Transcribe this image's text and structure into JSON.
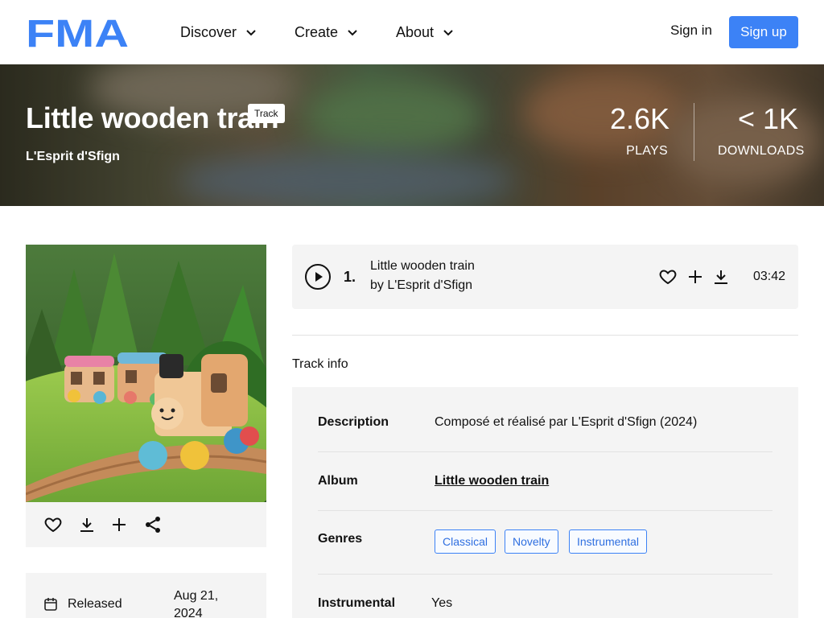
{
  "nav": {
    "logo_text": "FMA",
    "items": [
      {
        "label": "Discover"
      },
      {
        "label": "Create"
      },
      {
        "label": "About"
      }
    ],
    "sign_in": "Sign in",
    "sign_up": "Sign up"
  },
  "hero": {
    "title": "Little wooden train",
    "badge": "Track",
    "artist": "L'Esprit d'Sfign",
    "stats": [
      {
        "value": "2.6K",
        "label": "PLAYS"
      },
      {
        "value": "< 1K",
        "label": "DOWNLOADS"
      }
    ]
  },
  "released": {
    "label": "Released",
    "date": "Aug 21, 2024"
  },
  "track": {
    "number": "1.",
    "title": "Little wooden train",
    "by_prefix": "by",
    "artist": "L'Esprit d'Sfign",
    "duration": "03:42"
  },
  "track_info": {
    "heading": "Track info",
    "description_label": "Description",
    "description_value": "Composé et réalisé par L'Esprit d'Sfign (2024)",
    "album_label": "Album",
    "album_value": "Little wooden train",
    "genres_label": "Genres",
    "genres": [
      "Classical",
      "Novelty",
      "Instrumental"
    ],
    "instrumental_label": "Instrumental",
    "instrumental_value": "Yes"
  },
  "colors": {
    "accent": "#3c82f6",
    "panel_bg": "#f4f4f4"
  }
}
